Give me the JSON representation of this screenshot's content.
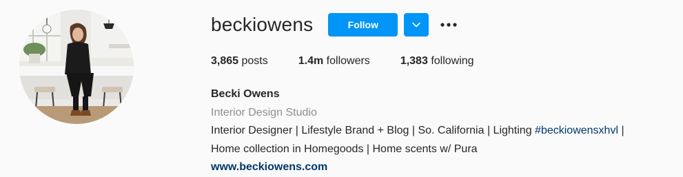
{
  "profile": {
    "username": "beckiowens",
    "avatar_icon": "profile-photo-woman-in-kitchen",
    "follow_label": "Follow",
    "dropdown_icon": "chevron-down-icon",
    "more_icon": "more-options-icon"
  },
  "stats": {
    "posts_count": "3,865",
    "posts_label": "posts",
    "followers_count": "1.4m",
    "followers_label": "followers",
    "following_count": "1,383",
    "following_label": "following"
  },
  "bio": {
    "name": "Becki Owens",
    "category": "Interior Design Studio",
    "line1_text": "Interior Designer | Lifestyle Brand + Blog | So. California | Lighting ",
    "line1_hashtag": "#beckiowensxhvl",
    "line1_tail": " |",
    "line2": "Home collection in Homegoods | Home scents w/ Pura",
    "website": "www.beckiowens.com"
  },
  "colors": {
    "background": "#fafafa",
    "primary_text": "#262626",
    "secondary_text": "#8e8e8e",
    "follow_button": "#0095f6",
    "link": "#00376b"
  }
}
